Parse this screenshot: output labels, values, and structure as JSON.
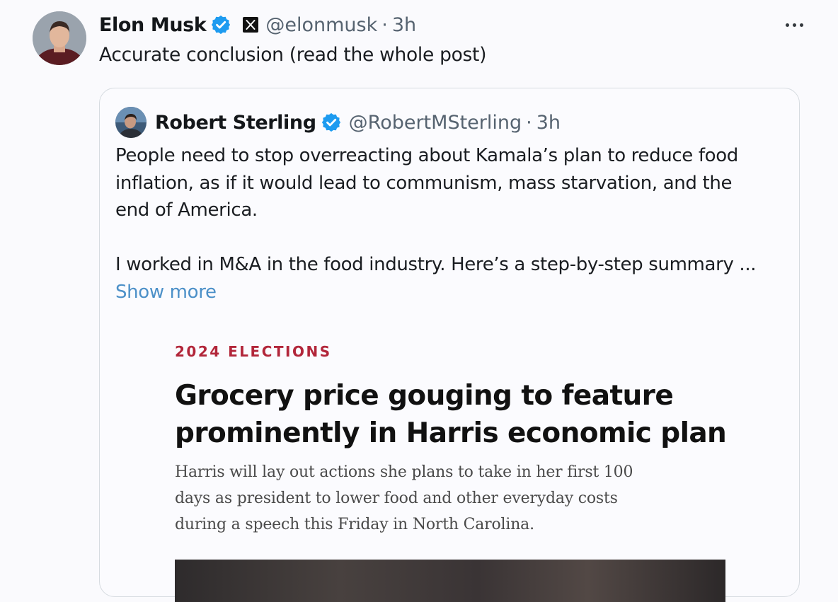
{
  "post": {
    "author_name": "Elon Musk",
    "handle": "@elonmusk",
    "separator": "·",
    "time": "3h",
    "more_icon": "more-horizontal-icon",
    "verified_icon": "verified-badge-icon",
    "affiliation_icon": "x-logo-icon",
    "text": "Accurate conclusion (read the whole post)"
  },
  "quote": {
    "author_name": "Robert Sterling",
    "handle": "@RobertMSterling",
    "separator": "·",
    "time": "3h",
    "verified_icon": "verified-badge-icon",
    "paragraph1": [
      "People need to stop overreacting about Kamala’s plan to reduce food",
      "inflation, as if it would lead to communism, mass starvation, and the",
      "end of America."
    ],
    "paragraph2": "I worked in M&A in the food industry. Here’s a step-by-step summary ...",
    "show_more": "Show more",
    "article": {
      "kicker": "2024 ELECTIONS",
      "headline": [
        "Grocery price gouging to feature",
        "prominently in Harris economic plan"
      ],
      "dek": [
        "Harris will lay out actions she plans to take in her first 100",
        "days as president to lower food and other everyday costs",
        "during a speech this Friday in North Carolina."
      ]
    }
  },
  "colors": {
    "verified": "#1d9bf0",
    "link": "#4c90c8",
    "kicker": "#b2263a",
    "secondary_text": "#566370"
  }
}
